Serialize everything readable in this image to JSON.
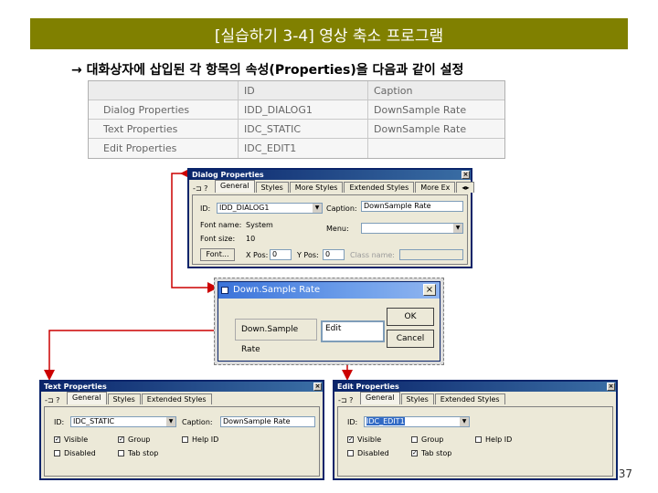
{
  "slide": {
    "title": "[실습하기 3-4] 영상 축소 프로그램",
    "subtitle": "→ 대화상자에 삽입된 각 항목의 속성(Properties)을 다음과 같이 설정",
    "page_number": "37",
    "colors": {
      "title_bar": "#808000",
      "connector": "#cc0000",
      "dialog_caption": "#0a246a"
    }
  },
  "prop_table": {
    "headers": [
      "ID",
      "Caption"
    ],
    "rows": [
      {
        "name": "Dialog Properties",
        "id": "IDD_DIALOG1",
        "caption": "DownSample Rate"
      },
      {
        "name": "Text Properties",
        "id": "IDC_STATIC",
        "caption": "DownSample Rate"
      },
      {
        "name": "Edit Properties",
        "id": "IDC_EDIT1",
        "caption": ""
      }
    ]
  },
  "dialog_props": {
    "title": "Dialog Properties",
    "close": "×",
    "pin_icon": "pin-icon",
    "help_icon": "help-icon",
    "tabs": [
      "General",
      "Styles",
      "More Styles",
      "Extended Styles",
      "More Ex"
    ],
    "id_label": "ID:",
    "id_value": "IDD_DIALOG1",
    "caption_label": "Caption:",
    "caption_value": "DownSample Rate",
    "font_name_label": "Font name:",
    "font_name_value": "System",
    "font_size_label": "Font size:",
    "font_size_value": "10",
    "menu_label": "Menu:",
    "font_button": "Font...",
    "xpos_label": "X Pos:",
    "xpos_value": "0",
    "ypos_label": "Y Pos:",
    "ypos_value": "0",
    "class_label": "Class name:"
  },
  "preview": {
    "title": "Down.Sample Rate",
    "static_text": "Down.Sample Rate",
    "edit_text": "Edit",
    "ok": "OK",
    "cancel": "Cancel",
    "close": "×"
  },
  "text_props": {
    "title": "Text Properties",
    "close": "×",
    "tabs": [
      "General",
      "Styles",
      "Extended Styles"
    ],
    "id_label": "ID:",
    "id_value": "IDC_STATIC",
    "caption_label": "Caption:",
    "caption_value": "DownSample Rate",
    "visible": "Visible",
    "group": "Group",
    "help_id": "Help ID",
    "disabled": "Disabled",
    "tab_stop": "Tab stop"
  },
  "edit_props": {
    "title": "Edit Properties",
    "close": "×",
    "tabs": [
      "General",
      "Styles",
      "Extended Styles"
    ],
    "id_label": "ID:",
    "id_value": "IDC_EDIT1",
    "visible": "Visible",
    "group": "Group",
    "help_id": "Help ID",
    "disabled": "Disabled",
    "tab_stop": "Tab stop"
  }
}
